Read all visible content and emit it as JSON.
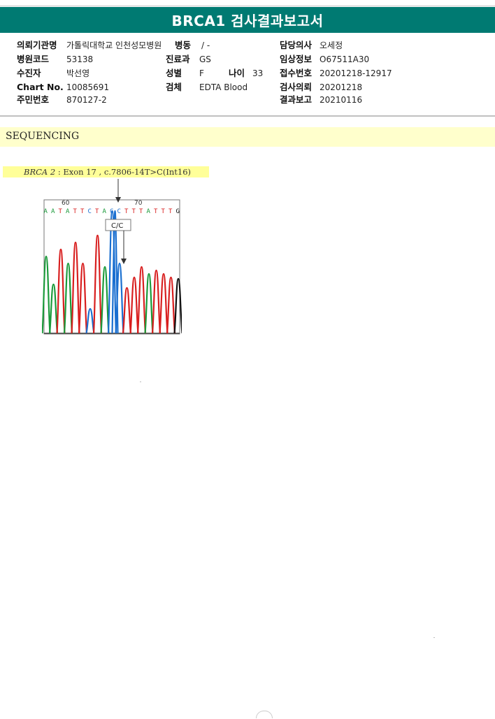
{
  "title": "BRCA1 검사결과보고서",
  "info": {
    "institution_label": "의뢰기관명",
    "institution_value": "가톨릭대학교 인천성모병원",
    "ward_label": "병동",
    "ward_value": "/ -",
    "doctor_label": "담당의사",
    "doctor_value": "오세정",
    "hospital_code_label": "병원코드",
    "hospital_code_value": "53138",
    "department_label": "진료과",
    "department_value": "GS",
    "clinical_info_label": "임상정보",
    "clinical_info_value": "O67511A30",
    "patient_label": "수진자",
    "patient_value": "박선영",
    "sex_label": "성별",
    "sex_value": "F",
    "age_label": "나이",
    "age_value": "33",
    "receipt_no_label": "접수번호",
    "receipt_no_value": "20201218-12917",
    "chart_no_label": "Chart No.",
    "chart_no_value": "10085691",
    "specimen_label": "검체",
    "specimen_value": "EDTA Blood",
    "request_date_label": "검사의뢰",
    "request_date_value": "20201218",
    "id_no_label": "주민번호",
    "id_no_value": "870127-2",
    "report_date_label": "결과보고",
    "report_date_value": "20210116"
  },
  "section_title": "SEQUENCING",
  "variant": {
    "gene": "BRCA 2",
    "description": ": Exon 17 , c.7806-14T>C(Int16)"
  },
  "chromatogram": {
    "position_labels": [
      "60",
      "70"
    ],
    "sequence": [
      "A",
      "A",
      "T",
      "A",
      "T",
      "T",
      "C",
      "T",
      "A",
      "C",
      "C",
      "T",
      "T",
      "T",
      "A",
      "T",
      "T",
      "T",
      "G"
    ],
    "genotype_call": "C/C",
    "base_colors": {
      "A": "#1a9a3a",
      "C": "#1a6fd0",
      "G": "#111111",
      "T": "#d81e1e"
    }
  }
}
